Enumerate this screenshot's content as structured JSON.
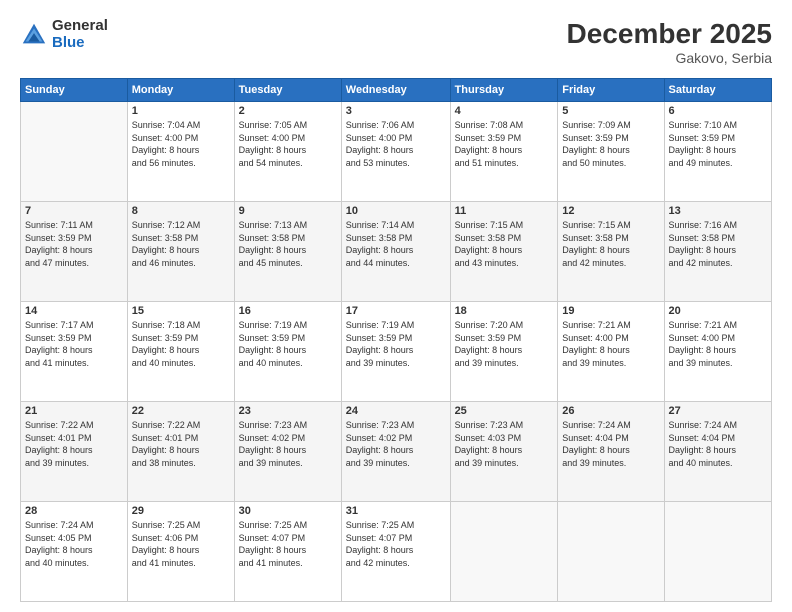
{
  "header": {
    "logo_general": "General",
    "logo_blue": "Blue",
    "month_year": "December 2025",
    "location": "Gakovo, Serbia"
  },
  "weekdays": [
    "Sunday",
    "Monday",
    "Tuesday",
    "Wednesday",
    "Thursday",
    "Friday",
    "Saturday"
  ],
  "weeks": [
    [
      {
        "day": "",
        "info": ""
      },
      {
        "day": "1",
        "info": "Sunrise: 7:04 AM\nSunset: 4:00 PM\nDaylight: 8 hours\nand 56 minutes."
      },
      {
        "day": "2",
        "info": "Sunrise: 7:05 AM\nSunset: 4:00 PM\nDaylight: 8 hours\nand 54 minutes."
      },
      {
        "day": "3",
        "info": "Sunrise: 7:06 AM\nSunset: 4:00 PM\nDaylight: 8 hours\nand 53 minutes."
      },
      {
        "day": "4",
        "info": "Sunrise: 7:08 AM\nSunset: 3:59 PM\nDaylight: 8 hours\nand 51 minutes."
      },
      {
        "day": "5",
        "info": "Sunrise: 7:09 AM\nSunset: 3:59 PM\nDaylight: 8 hours\nand 50 minutes."
      },
      {
        "day": "6",
        "info": "Sunrise: 7:10 AM\nSunset: 3:59 PM\nDaylight: 8 hours\nand 49 minutes."
      }
    ],
    [
      {
        "day": "7",
        "info": "Sunrise: 7:11 AM\nSunset: 3:59 PM\nDaylight: 8 hours\nand 47 minutes."
      },
      {
        "day": "8",
        "info": "Sunrise: 7:12 AM\nSunset: 3:58 PM\nDaylight: 8 hours\nand 46 minutes."
      },
      {
        "day": "9",
        "info": "Sunrise: 7:13 AM\nSunset: 3:58 PM\nDaylight: 8 hours\nand 45 minutes."
      },
      {
        "day": "10",
        "info": "Sunrise: 7:14 AM\nSunset: 3:58 PM\nDaylight: 8 hours\nand 44 minutes."
      },
      {
        "day": "11",
        "info": "Sunrise: 7:15 AM\nSunset: 3:58 PM\nDaylight: 8 hours\nand 43 minutes."
      },
      {
        "day": "12",
        "info": "Sunrise: 7:15 AM\nSunset: 3:58 PM\nDaylight: 8 hours\nand 42 minutes."
      },
      {
        "day": "13",
        "info": "Sunrise: 7:16 AM\nSunset: 3:58 PM\nDaylight: 8 hours\nand 42 minutes."
      }
    ],
    [
      {
        "day": "14",
        "info": "Sunrise: 7:17 AM\nSunset: 3:59 PM\nDaylight: 8 hours\nand 41 minutes."
      },
      {
        "day": "15",
        "info": "Sunrise: 7:18 AM\nSunset: 3:59 PM\nDaylight: 8 hours\nand 40 minutes."
      },
      {
        "day": "16",
        "info": "Sunrise: 7:19 AM\nSunset: 3:59 PM\nDaylight: 8 hours\nand 40 minutes."
      },
      {
        "day": "17",
        "info": "Sunrise: 7:19 AM\nSunset: 3:59 PM\nDaylight: 8 hours\nand 39 minutes."
      },
      {
        "day": "18",
        "info": "Sunrise: 7:20 AM\nSunset: 3:59 PM\nDaylight: 8 hours\nand 39 minutes."
      },
      {
        "day": "19",
        "info": "Sunrise: 7:21 AM\nSunset: 4:00 PM\nDaylight: 8 hours\nand 39 minutes."
      },
      {
        "day": "20",
        "info": "Sunrise: 7:21 AM\nSunset: 4:00 PM\nDaylight: 8 hours\nand 39 minutes."
      }
    ],
    [
      {
        "day": "21",
        "info": "Sunrise: 7:22 AM\nSunset: 4:01 PM\nDaylight: 8 hours\nand 39 minutes."
      },
      {
        "day": "22",
        "info": "Sunrise: 7:22 AM\nSunset: 4:01 PM\nDaylight: 8 hours\nand 38 minutes."
      },
      {
        "day": "23",
        "info": "Sunrise: 7:23 AM\nSunset: 4:02 PM\nDaylight: 8 hours\nand 39 minutes."
      },
      {
        "day": "24",
        "info": "Sunrise: 7:23 AM\nSunset: 4:02 PM\nDaylight: 8 hours\nand 39 minutes."
      },
      {
        "day": "25",
        "info": "Sunrise: 7:23 AM\nSunset: 4:03 PM\nDaylight: 8 hours\nand 39 minutes."
      },
      {
        "day": "26",
        "info": "Sunrise: 7:24 AM\nSunset: 4:04 PM\nDaylight: 8 hours\nand 39 minutes."
      },
      {
        "day": "27",
        "info": "Sunrise: 7:24 AM\nSunset: 4:04 PM\nDaylight: 8 hours\nand 40 minutes."
      }
    ],
    [
      {
        "day": "28",
        "info": "Sunrise: 7:24 AM\nSunset: 4:05 PM\nDaylight: 8 hours\nand 40 minutes."
      },
      {
        "day": "29",
        "info": "Sunrise: 7:25 AM\nSunset: 4:06 PM\nDaylight: 8 hours\nand 41 minutes."
      },
      {
        "day": "30",
        "info": "Sunrise: 7:25 AM\nSunset: 4:07 PM\nDaylight: 8 hours\nand 41 minutes."
      },
      {
        "day": "31",
        "info": "Sunrise: 7:25 AM\nSunset: 4:07 PM\nDaylight: 8 hours\nand 42 minutes."
      },
      {
        "day": "",
        "info": ""
      },
      {
        "day": "",
        "info": ""
      },
      {
        "day": "",
        "info": ""
      }
    ]
  ]
}
